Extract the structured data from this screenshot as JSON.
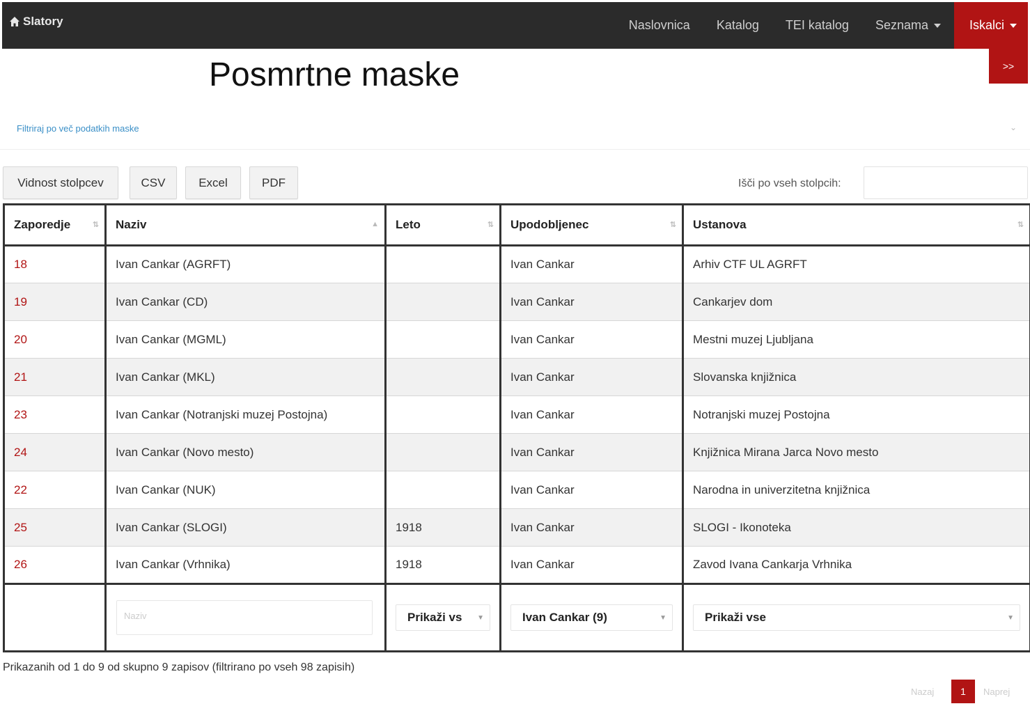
{
  "navbar": {
    "brand": "Slatory",
    "items": [
      {
        "label": "Naslovnica"
      },
      {
        "label": "Katalog"
      },
      {
        "label": "TEI katalog"
      },
      {
        "label": "Seznama"
      },
      {
        "label": "Iskalci"
      }
    ]
  },
  "collapse_label": ">>",
  "page": {
    "title": "Posmrtne maske"
  },
  "filter_link": "Filtriraj po več podatkih maske",
  "buttons": {
    "columns": "Vidnost stolpcev",
    "csv": "CSV",
    "excel": "Excel",
    "pdf": "PDF"
  },
  "search": {
    "label": "Išči po vseh stolpcih:",
    "value": ""
  },
  "table": {
    "headers": [
      "Zaporedje",
      "Naziv",
      "Leto",
      "Upodobljenec",
      "Ustanova"
    ],
    "rows": [
      {
        "id": "18",
        "naziv": "Ivan Cankar (AGRFT)",
        "leto": "",
        "upodobljenec": "Ivan Cankar",
        "ustanova": "Arhiv CTF UL AGRFT"
      },
      {
        "id": "19",
        "naziv": "Ivan Cankar (CD)",
        "leto": "",
        "upodobljenec": "Ivan Cankar",
        "ustanova": "Cankarjev dom"
      },
      {
        "id": "20",
        "naziv": "Ivan Cankar (MGML)",
        "leto": "",
        "upodobljenec": "Ivan Cankar",
        "ustanova": "Mestni muzej Ljubljana"
      },
      {
        "id": "21",
        "naziv": "Ivan Cankar (MKL)",
        "leto": "",
        "upodobljenec": "Ivan Cankar",
        "ustanova": "Slovanska knjižnica"
      },
      {
        "id": "23",
        "naziv": "Ivan Cankar (Notranjski muzej Postojna)",
        "leto": "",
        "upodobljenec": "Ivan Cankar",
        "ustanova": "Notranjski muzej Postojna"
      },
      {
        "id": "24",
        "naziv": "Ivan Cankar (Novo mesto)",
        "leto": "",
        "upodobljenec": "Ivan Cankar",
        "ustanova": "Knjižnica Mirana Jarca Novo mesto"
      },
      {
        "id": "22",
        "naziv": "Ivan Cankar (NUK)",
        "leto": "",
        "upodobljenec": "Ivan Cankar",
        "ustanova": "Narodna in univerzitetna knjižnica"
      },
      {
        "id": "25",
        "naziv": "Ivan Cankar (SLOGI)",
        "leto": "1918",
        "upodobljenec": "Ivan Cankar",
        "ustanova": "SLOGI - Ikonoteka"
      },
      {
        "id": "26",
        "naziv": "Ivan Cankar (Vrhnika)",
        "leto": "1918",
        "upodobljenec": "Ivan Cankar",
        "ustanova": "Zavod Ivana Cankarja Vrhnika"
      }
    ],
    "footer": {
      "naziv_placeholder": "Naziv",
      "leto_select": "Prikaži vs",
      "upodobljenec_select": "Ivan Cankar (9)",
      "ustanova_select": "Prikaži vse"
    }
  },
  "info_text": "Prikazanih od 1 do 9 od skupno 9 zapisov (filtrirano po vseh 98 zapisih)",
  "pagination": {
    "prev": "Nazaj",
    "current": "1",
    "next": "Naprej"
  }
}
